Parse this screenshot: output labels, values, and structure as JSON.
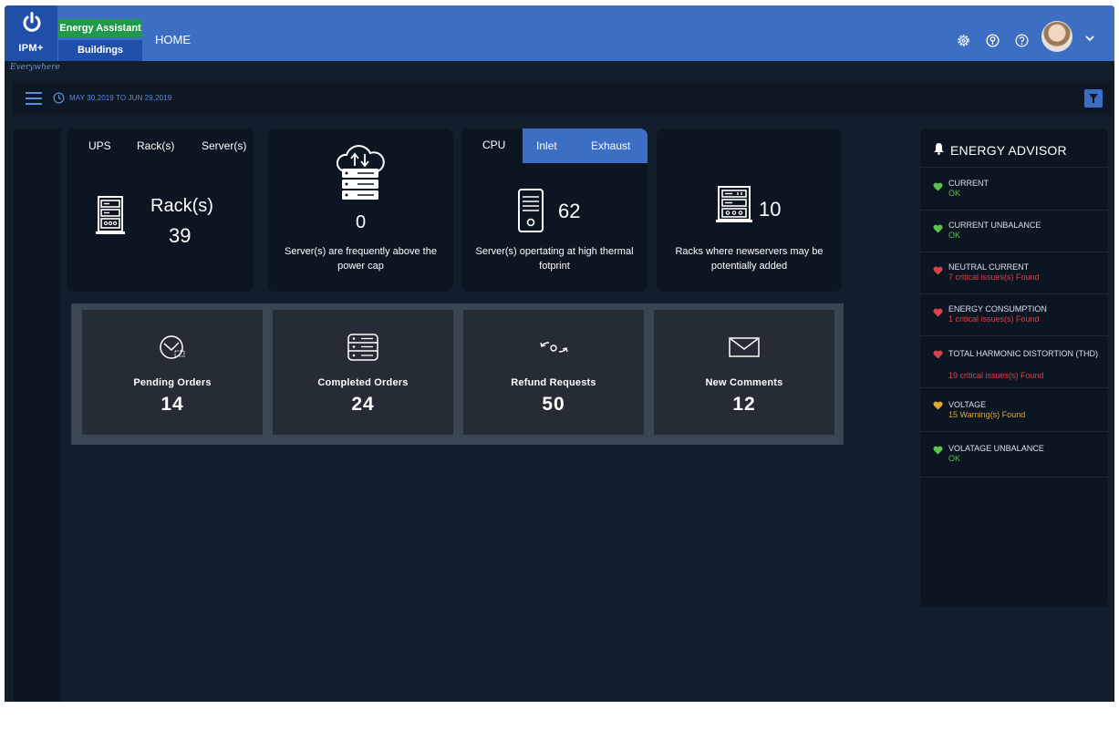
{
  "header": {
    "logo_text": "IPM+",
    "app_badge": "Energy Assistant",
    "module_badge": "Buildings",
    "breadcrumb": "HOME",
    "brand_signature": "Everywhere"
  },
  "toolbar": {
    "date_range": "MAY 30,2019 TO JUN 29,2019"
  },
  "cards": {
    "devices": {
      "tabs": [
        "UPS",
        "Rack(s)",
        "Server(s)"
      ],
      "label": "Rack(s)",
      "value": "39"
    },
    "power_cap": {
      "value": "0",
      "description": "Server(s) are frequently above the power cap"
    },
    "thermal": {
      "tabs": [
        "CPU",
        "Inlet",
        "Exhaust"
      ],
      "value": "62",
      "description": "Server(s) opertating at high thermal fotprint"
    },
    "capacity": {
      "value": "10",
      "description": "Racks where newservers may be potentially added"
    }
  },
  "orders": [
    {
      "label": "Pending Orders",
      "value": "14",
      "icon": "clock-icon"
    },
    {
      "label": "Completed Orders",
      "value": "24",
      "icon": "server-stack-icon"
    },
    {
      "label": "Refund Requests",
      "value": "50",
      "icon": "refund-icon"
    },
    {
      "label": "New Comments",
      "value": "12",
      "icon": "envelope-icon"
    }
  ],
  "advisor": {
    "title": "ENERGY ADVISOR",
    "items": [
      {
        "name": "CURRENT",
        "status": "OK",
        "level": "ok"
      },
      {
        "name": "CURRENT UNBALANCE",
        "status": "OK",
        "level": "ok"
      },
      {
        "name": "NEUTRAL CURRENT",
        "status": "7 critical issues(s) Found",
        "level": "critical"
      },
      {
        "name": "ENERGY CONSUMPTION",
        "status": "1 critical issues(s) Found",
        "level": "critical"
      },
      {
        "name": "TOTAL HARMONIC DISTORTION (THD)",
        "status": "19 critical issues(s) Found",
        "level": "critical"
      },
      {
        "name": "VOLTAGE",
        "status": "15 Warning(s) Found",
        "level": "warning"
      },
      {
        "name": "VOLATAGE UNBALANCE",
        "status": "OK",
        "level": "ok"
      }
    ]
  },
  "colors": {
    "header_blue": "#3c6fc3",
    "accent_green": "#1f9a4a",
    "ok": "#5bc24a",
    "critical": "#d9424a",
    "warning": "#e3a82b"
  }
}
